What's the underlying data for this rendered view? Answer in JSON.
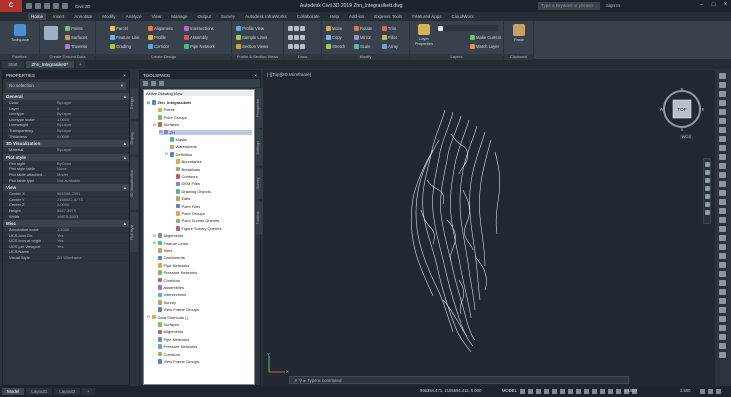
{
  "app": {
    "logo": "C",
    "workspace": "Civil 3D",
    "title": "Autodesk Civil 3D 2019   Zhn_Integrasikett.dwg",
    "search_placeholder": "Type a keyword or phrase",
    "signin": "Sign In"
  },
  "ribbon_tabs": [
    "Home",
    "Insert",
    "Annotate",
    "Modify",
    "Analyze",
    "View",
    "Manage",
    "Output",
    "Survey",
    "Autodesk InfraWorks",
    "Collaborate",
    "Help",
    "Add-ins",
    "Express Tools",
    "Featured Apps",
    "CloudWorx"
  ],
  "ribbon": {
    "groups": {
      "palettes": "Palettes",
      "create_ground": "Create Ground Data",
      "create_design": "Create Design",
      "profile_section": "Profile & Section Views",
      "draw": "Draw",
      "modify": "Modify",
      "layers": "Layers",
      "clipboard": "Clipboard"
    },
    "big": {
      "toolspace": "Toolspace",
      "layer_props": "Layer Properties",
      "paste": "Paste"
    },
    "items": {
      "points": "Points",
      "surfaces": "Surfaces",
      "traverse": "Traverse",
      "parcel": "Parcel",
      "feature_line": "Feature Line",
      "grading": "Grading",
      "alignment": "Alignment",
      "profile": "Profile",
      "corridor": "Corridor",
      "intersections": "Intersections",
      "assembly": "Assembly",
      "pipe_network": "Pipe Network",
      "profile_view": "Profile View",
      "sample_lines": "Sample Lines",
      "section_views": "Section Views",
      "move": "Move",
      "copy": "Copy",
      "stretch": "Stretch",
      "rotate": "Rotate",
      "mirror": "Mirror",
      "scale": "Scale",
      "trim": "Trim",
      "fillet": "Fillet",
      "array": "Array",
      "make_current": "Make Current",
      "match_layer": "Match Layer"
    }
  },
  "doc_tabs": [
    "Start",
    "Zhn_Integrasikett*",
    "+"
  ],
  "properties": {
    "title": "PROPERTIES",
    "selection": "No selection",
    "sections": [
      {
        "name": "General",
        "rows": [
          [
            "Color",
            "ByLayer"
          ],
          [
            "Layer",
            "0"
          ],
          [
            "Linetype",
            "ByLayer"
          ],
          [
            "Linetype scale",
            "1.0000"
          ],
          [
            "Lineweight",
            "ByLayer"
          ],
          [
            "Transparency",
            "ByLayer"
          ],
          [
            "Thickness",
            "0.0000"
          ]
        ]
      },
      {
        "name": "3D Visualization",
        "rows": [
          [
            "Material",
            "ByLayer"
          ]
        ]
      },
      {
        "name": "Plot style",
        "rows": [
          [
            "Plot style",
            "ByColor"
          ],
          [
            "Plot style table",
            "None"
          ],
          [
            "Plot table attached...",
            "Model"
          ],
          [
            "Plot table type",
            "Not available"
          ]
        ]
      },
      {
        "name": "View",
        "rows": [
          [
            "Center X",
            "961008.2391"
          ],
          [
            "Center Y",
            "2158022.4773"
          ],
          [
            "Center Z",
            "0.0000"
          ],
          [
            "Height",
            "9827.3979"
          ],
          [
            "Width",
            "19875.3203"
          ]
        ]
      },
      {
        "name": "Misc",
        "rows": [
          [
            "Annotation scale",
            "1:1000"
          ],
          [
            "UCS icon On",
            "Yes"
          ],
          [
            "UCS icon at origin",
            "Yes"
          ],
          [
            "UCS per viewport",
            "Yes"
          ],
          [
            "UCS Name",
            ""
          ],
          [
            "Visual Style",
            "2D Wireframe"
          ]
        ]
      }
    ],
    "side_tabs": [
      "Design",
      "Display",
      "3D Visualization",
      "Plot style"
    ]
  },
  "toolspace": {
    "title": "TOOLSPACE",
    "view": "Active Drawing View",
    "tree": [
      {
        "label": "Zhn_Integrasikett",
        "level": 0,
        "bold": true,
        "icon": "drawing-icon"
      },
      {
        "label": "Points",
        "level": 1,
        "icon": "points-icon"
      },
      {
        "label": "Point Groups",
        "level": 1,
        "icon": "point-groups-icon"
      },
      {
        "label": "Surfaces",
        "level": 1,
        "icon": "surfaces-icon"
      },
      {
        "label": "ZH",
        "level": 2,
        "icon": "surface-icon",
        "selected": true
      },
      {
        "label": "Masks",
        "level": 3,
        "icon": "masks-icon"
      },
      {
        "label": "Watersheds",
        "level": 3,
        "icon": "watersheds-icon"
      },
      {
        "label": "Definition",
        "level": 3,
        "icon": "definition-icon"
      },
      {
        "label": "Boundaries",
        "level": 4,
        "icon": "boundaries-icon"
      },
      {
        "label": "Breaklines",
        "level": 4,
        "icon": "breaklines-icon"
      },
      {
        "label": "Contours",
        "level": 4,
        "icon": "contours-icon"
      },
      {
        "label": "DEM Files",
        "level": 4,
        "icon": "dem-icon"
      },
      {
        "label": "Drawing Objects",
        "level": 4,
        "icon": "drawing-objects-icon"
      },
      {
        "label": "Edits",
        "level": 4,
        "icon": "edits-icon"
      },
      {
        "label": "Point Files",
        "level": 4,
        "icon": "point-files-icon"
      },
      {
        "label": "Point Groups",
        "level": 4,
        "icon": "point-groups-icon"
      },
      {
        "label": "Point Survey Queries",
        "level": 4,
        "icon": "query-icon"
      },
      {
        "label": "Figure Survey Queries",
        "level": 4,
        "icon": "query-icon"
      },
      {
        "label": "Alignments",
        "level": 1,
        "icon": "alignments-icon"
      },
      {
        "label": "Feature Lines",
        "level": 1,
        "icon": "feature-lines-icon"
      },
      {
        "label": "Sites",
        "level": 1,
        "icon": "sites-icon"
      },
      {
        "label": "Catchments",
        "level": 1,
        "icon": "catchments-icon"
      },
      {
        "label": "Pipe Networks",
        "level": 1,
        "icon": "pipe-networks-icon"
      },
      {
        "label": "Pressure Networks",
        "level": 1,
        "icon": "pressure-networks-icon"
      },
      {
        "label": "Corridors",
        "level": 1,
        "icon": "corridors-icon"
      },
      {
        "label": "Assemblies",
        "level": 1,
        "icon": "assemblies-icon"
      },
      {
        "label": "Intersections",
        "level": 1,
        "icon": "intersections-icon"
      },
      {
        "label": "Survey",
        "level": 1,
        "icon": "survey-icon"
      },
      {
        "label": "View Frame Groups",
        "level": 1,
        "icon": "view-frame-icon"
      },
      {
        "label": "Data Shortcuts [ ]",
        "level": 0,
        "icon": "data-shortcuts-icon"
      },
      {
        "label": "Surfaces",
        "level": 1,
        "icon": "surfaces-icon"
      },
      {
        "label": "Alignments",
        "level": 1,
        "icon": "alignments-icon"
      },
      {
        "label": "Pipe Networks",
        "level": 1,
        "icon": "pipe-networks-icon"
      },
      {
        "label": "Pressure Networks",
        "level": 1,
        "icon": "pressure-networks-icon"
      },
      {
        "label": "Corridors",
        "level": 1,
        "icon": "corridors-icon"
      },
      {
        "label": "View Frame Groups",
        "level": 1,
        "icon": "view-frame-icon"
      }
    ],
    "side_tabs": [
      "Prospector",
      "Settings",
      "Survey",
      "Toolbox"
    ]
  },
  "canvas": {
    "viewport_label": "[-][Top][2D Wireframe]",
    "viewcube_face": "TOP",
    "compass": {
      "n": "N",
      "s": "S",
      "e": "E",
      "w": "W"
    },
    "wcs": "WCS",
    "command_placeholder": "Type a command",
    "ucs": {
      "x": "X",
      "y": "Y"
    }
  },
  "status": {
    "layout_tabs": [
      "Model",
      "Layout1",
      "Layout2",
      "+"
    ],
    "coords": "966384.471, 2155584.411, 0.000",
    "model": "MODEL",
    "scale": "1:1000",
    "zoom": "3.500"
  },
  "colors": {
    "accent": "#b3322e",
    "ribbon": "#38424c",
    "canvas": "#212830",
    "contour": "#d8dde2",
    "selection": "#b9cbe0"
  }
}
